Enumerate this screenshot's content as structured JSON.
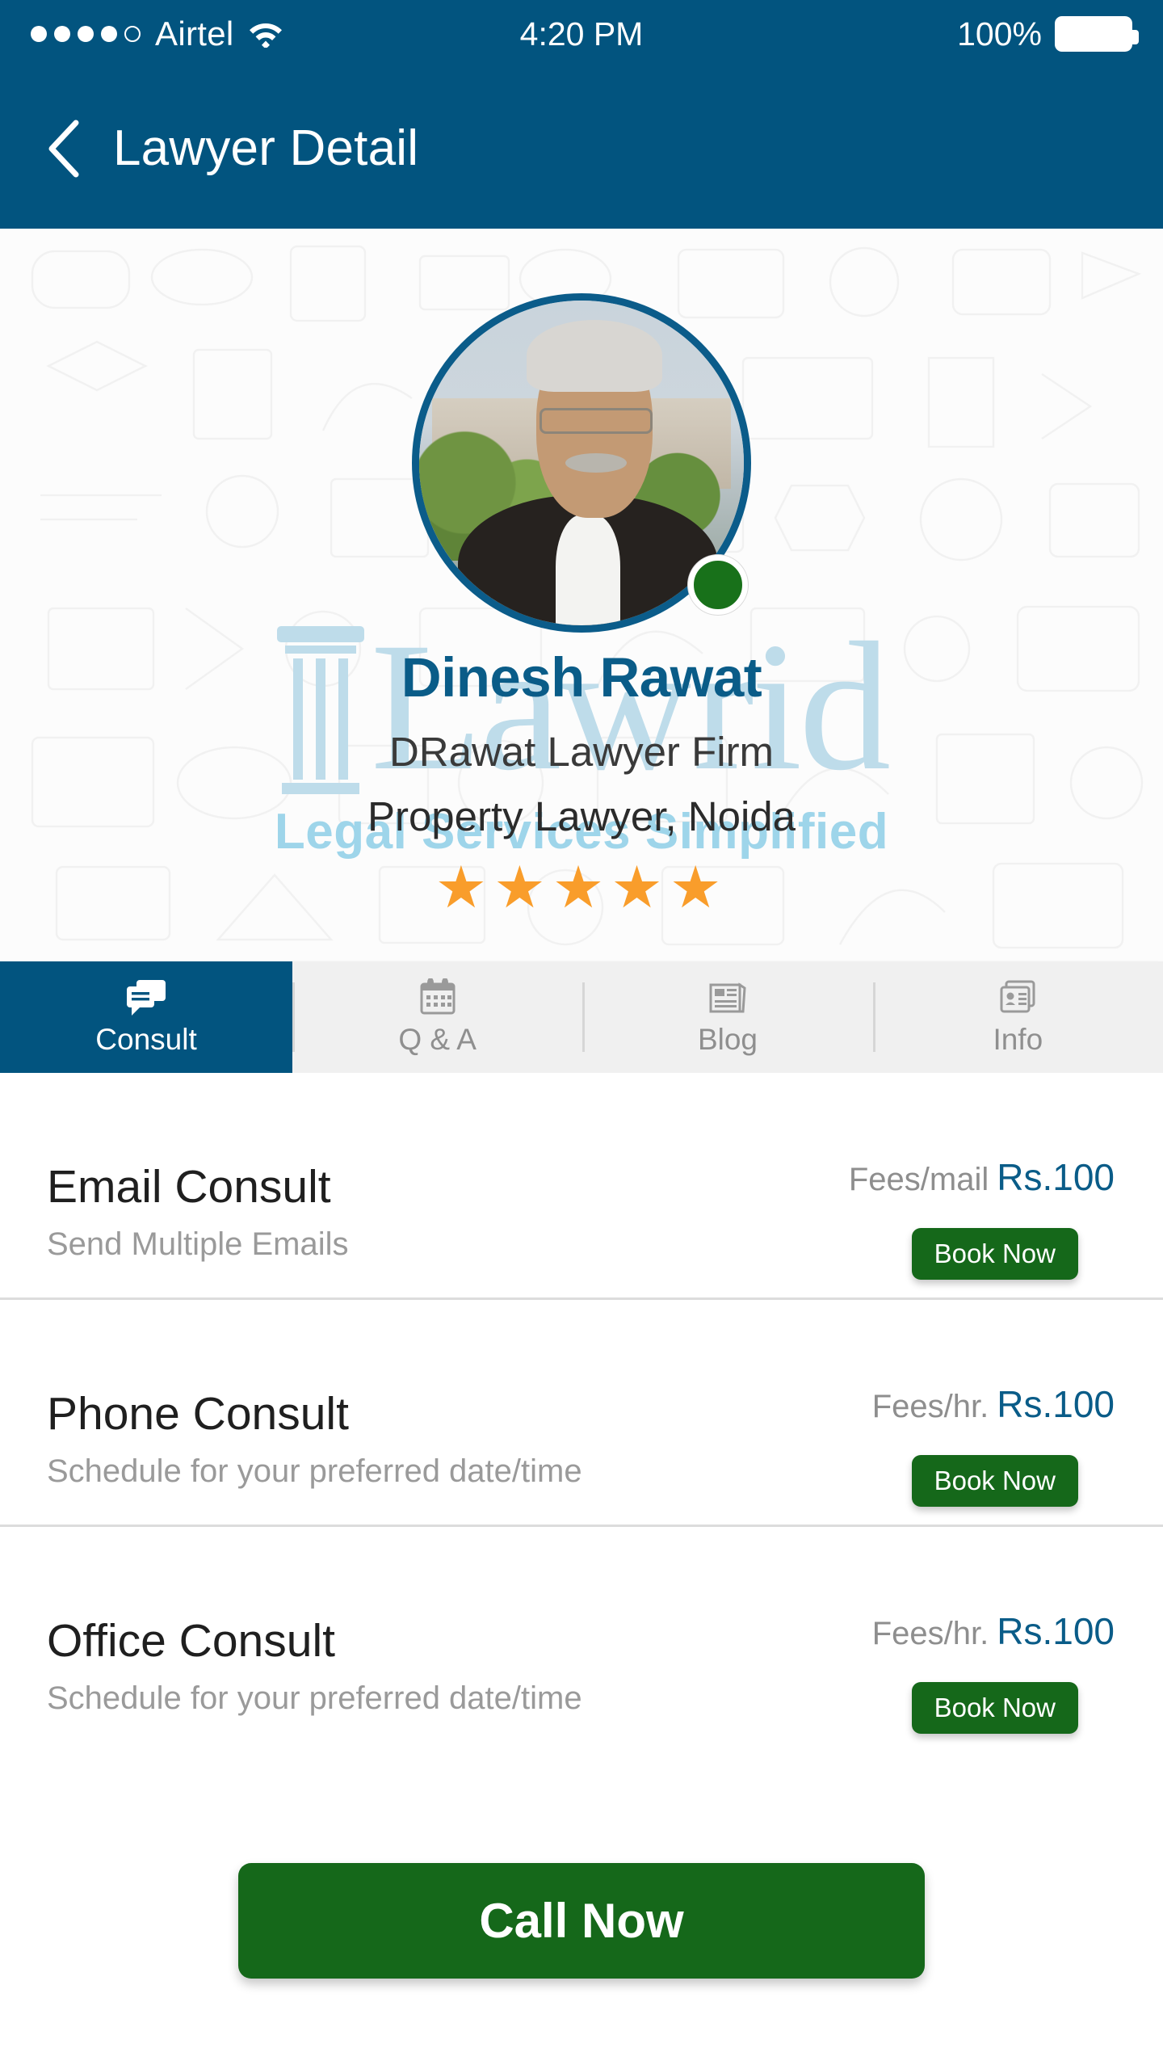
{
  "status_bar": {
    "carrier": "Airtel",
    "signal_dots_total": 5,
    "signal_dots_filled": 4,
    "wifi_icon": "wifi-icon",
    "time": "4:20 PM",
    "battery_percent": "100%",
    "battery_icon": "battery-full-icon"
  },
  "header": {
    "back_icon": "chevron-left-icon",
    "title": "Lawyer Detail",
    "background_color": "#02547f"
  },
  "watermark": {
    "word_left": "Law",
    "word_right": "rid",
    "tagline": "Legal Services Simplified",
    "color": "#bedcea"
  },
  "profile": {
    "avatar_icon": "lawyer-avatar",
    "online_status": "online",
    "online_color": "#18711a",
    "name": "Dinesh Rawat",
    "name_color": "#0a5c88",
    "firm": "DRawat Lawyer Firm",
    "specialization": "Property Lawyer, Noida",
    "rating": 5,
    "rating_max": 5,
    "star_glyph": "★",
    "star_color": "#f99d2b"
  },
  "tabs": [
    {
      "label": "Consult",
      "icon": "chat-bubbles-icon",
      "active": true
    },
    {
      "label": "Q & A",
      "icon": "calendar-icon",
      "active": false
    },
    {
      "label": "Blog",
      "icon": "newspaper-icon",
      "active": false
    },
    {
      "label": "Info",
      "icon": "id-card-icon",
      "active": false
    }
  ],
  "consult_rows": [
    {
      "title": "Email Consult",
      "subtitle": "Send Multiple Emails",
      "fee_label": "Fees/mail",
      "fee_value": "Rs.100",
      "button_label": "Book Now"
    },
    {
      "title": "Phone Consult",
      "subtitle": "Schedule for your preferred date/time",
      "fee_label": "Fees/hr.",
      "fee_value": "Rs.100",
      "button_label": "Book Now"
    },
    {
      "title": "Office Consult",
      "subtitle": "Schedule for your preferred date/time",
      "fee_label": "Fees/hr.",
      "fee_value": "Rs.100",
      "button_label": "Book Now"
    }
  ],
  "call_action": {
    "label": "Call Now",
    "color": "#15681a"
  }
}
